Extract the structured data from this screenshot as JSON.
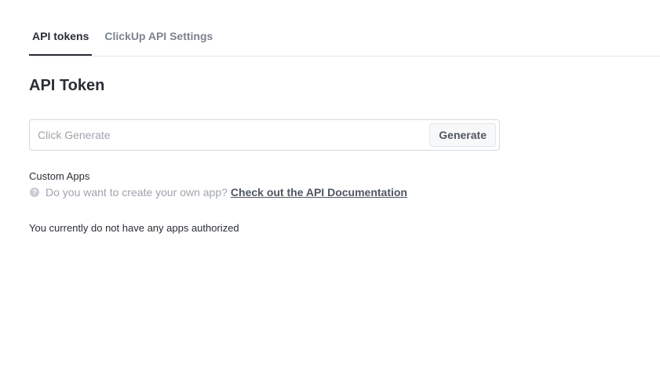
{
  "tabs": [
    {
      "label": "API tokens",
      "active": true
    },
    {
      "label": "ClickUp API Settings",
      "active": false
    }
  ],
  "section": {
    "title": "API Token"
  },
  "token": {
    "placeholder": "Click Generate",
    "value": "",
    "generate_label": "Generate"
  },
  "custom_apps": {
    "label": "Custom Apps",
    "help_icon": "question-circle-icon",
    "help_text": "Do you want to create your own app?",
    "link_text": "Check out the API Documentation"
  },
  "status": {
    "no_apps_text": "You currently do not have any apps authorized"
  },
  "colors": {
    "text_primary": "#2a2e34",
    "text_muted": "#9ea3ab",
    "link": "#4f5762",
    "border": "#d6d9de"
  }
}
